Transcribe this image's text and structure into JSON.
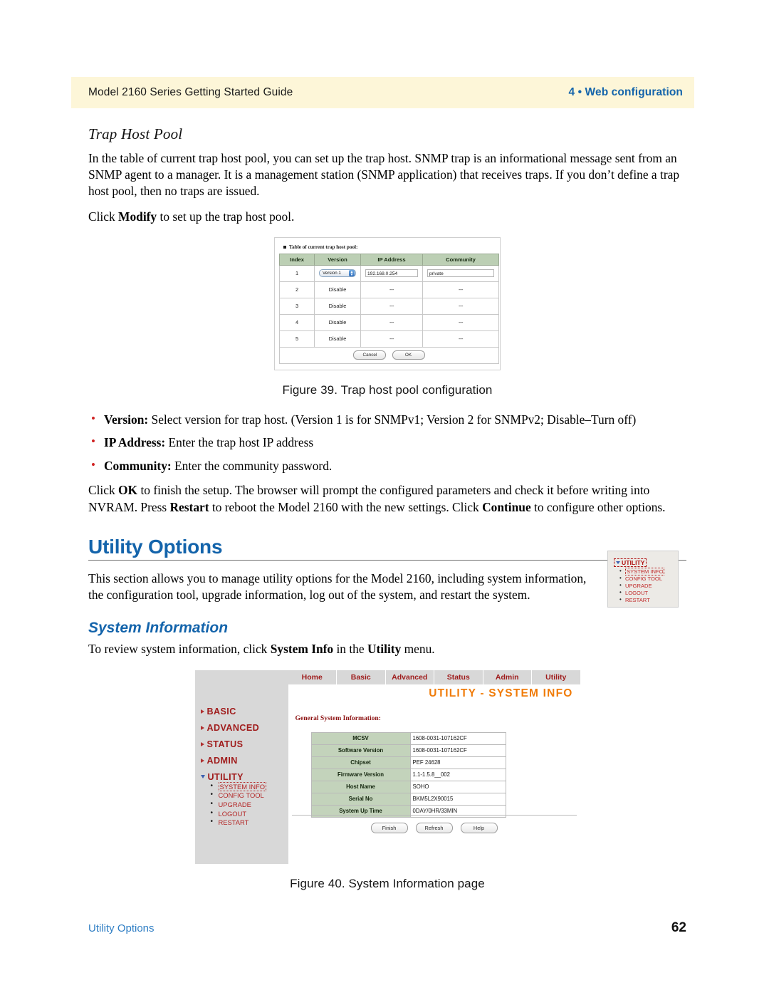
{
  "header": {
    "left": "Model 2160 Series Getting Started Guide",
    "right": "4 • Web configuration"
  },
  "trap_section": {
    "heading": "Trap Host Pool",
    "para1": "In the table of current trap host pool, you can set up the trap host. SNMP trap is an informational message sent from an SNMP agent to a manager. It is a management station (SNMP application) that receives traps. If you don’t define a trap host pool, then no traps are issued.",
    "para2_pre": "Click ",
    "para2_bold": "Modify",
    "para2_post": " to set up the trap host pool."
  },
  "figure39": {
    "legend": "Table of current trap host pool:",
    "columns": [
      "Index",
      "Version",
      "IP Address",
      "Community"
    ],
    "rows": [
      {
        "index": "1",
        "version": "Version 1",
        "version_type": "select",
        "ip": "192.168.0.254",
        "community": "private"
      },
      {
        "index": "2",
        "version": "Disable",
        "version_type": "text",
        "ip": "---",
        "community": "---"
      },
      {
        "index": "3",
        "version": "Disable",
        "version_type": "text",
        "ip": "---",
        "community": "---"
      },
      {
        "index": "4",
        "version": "Disable",
        "version_type": "text",
        "ip": "---",
        "community": "---"
      },
      {
        "index": "5",
        "version": "Disable",
        "version_type": "text",
        "ip": "---",
        "community": "---"
      }
    ],
    "cancel_label": "Cancel",
    "ok_label": "OK",
    "caption": "Figure 39. Trap host pool configuration"
  },
  "bullets": [
    {
      "term": "Version:",
      "text": " Select version for trap host. (Version 1 is for SNMPv1; Version 2 for SNMPv2; Disable–Turn off)"
    },
    {
      "term": "IP Address:",
      "text": " Enter the trap host IP address"
    },
    {
      "term": "Community:",
      "text": " Enter the community password."
    }
  ],
  "ok_para": {
    "s1": "Click ",
    "b1": "OK",
    "s2": " to finish the setup. The browser will prompt the configured parameters and check it before writing into NVRAM. Press ",
    "b2": "Restart",
    "s3": " to reboot the Model 2160 with the new settings. Click ",
    "b3": "Continue",
    "s4": " to configure other options."
  },
  "utility_options": {
    "heading": "Utility Options",
    "para": "This section allows you to manage utility options for the Model 2160, including system information, the configuration tool, upgrade information, log out of the system, and restart the system."
  },
  "utility_thumb": {
    "title": "UTILITY",
    "items": [
      "SYSTEM INFO",
      "CONFIG TOOL",
      "UPGRADE",
      "LOGOUT",
      "RESTART"
    ],
    "selected": "SYSTEM INFO"
  },
  "system_information": {
    "heading": "System Information",
    "para_pre": "To review system information, click ",
    "para_b1": "System Info",
    "para_mid": " in the ",
    "para_b2": "Utility",
    "para_post": " menu."
  },
  "figure40": {
    "nav": [
      "Home",
      "Basic",
      "Advanced",
      "Status",
      "Admin",
      "Utility"
    ],
    "page_title": "UTILITY - SYSTEM INFO",
    "section_label": "General System Information:",
    "sidebar": [
      {
        "label": "BASIC",
        "expanded": false
      },
      {
        "label": "ADVANCED",
        "expanded": false
      },
      {
        "label": "STATUS",
        "expanded": false
      },
      {
        "label": "ADMIN",
        "expanded": false
      },
      {
        "label": "UTILITY",
        "expanded": true
      }
    ],
    "sidebar_sub": [
      "SYSTEM INFO",
      "CONFIG TOOL",
      "UPGRADE",
      "LOGOUT",
      "RESTART"
    ],
    "sidebar_selected": "SYSTEM INFO",
    "table": [
      {
        "key": "MCSV",
        "value": "1608-0031-107162CF"
      },
      {
        "key": "Software Version",
        "value": "1608-0031-107162CF"
      },
      {
        "key": "Chipset",
        "value": "PEF 24628"
      },
      {
        "key": "Firmware Version",
        "value": "1.1-1.5.8__002"
      },
      {
        "key": "Host Name",
        "value": "SOHO"
      },
      {
        "key": "Serial No",
        "value": "BKM5L2X90015"
      },
      {
        "key": "System Up Time",
        "value": "0DAY/0HR/33MIN"
      }
    ],
    "buttons": [
      "Finish",
      "Refresh",
      "Help"
    ],
    "caption": "Figure 40. System Information page"
  },
  "footer": {
    "left": "Utility Options",
    "page": "62"
  },
  "colors": {
    "header_band": "#fdf6d8",
    "brand_blue": "#1464ab",
    "bullet_red": "#d02323",
    "menu_red": "#a01c1c",
    "title_orange": "#f07c0a",
    "table_header_green": "#bccfb4",
    "ui_gray": "#d8d8d8"
  }
}
